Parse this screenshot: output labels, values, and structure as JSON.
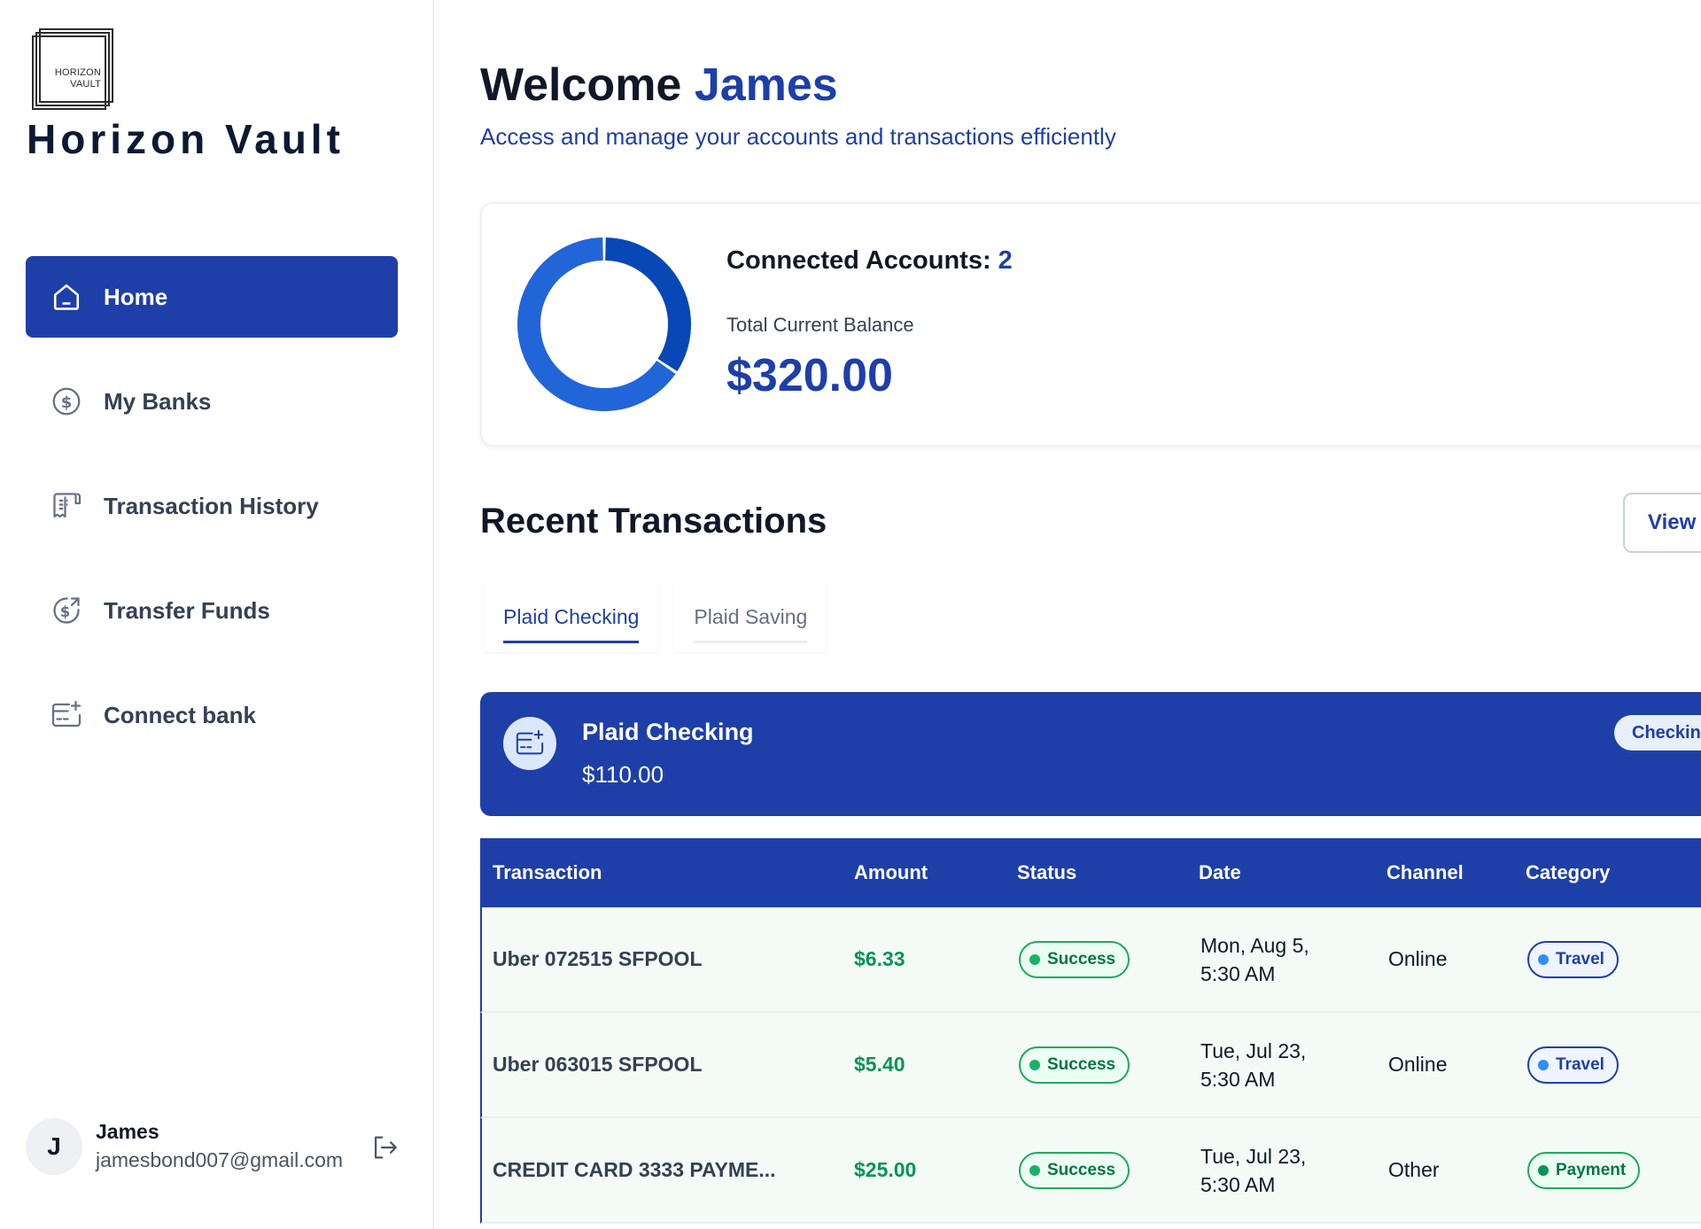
{
  "brand": {
    "logo_text_line1": "HORIZON",
    "logo_text_line2": "VAULT",
    "name": "Horizon Vault"
  },
  "nav": {
    "items": [
      {
        "label": "Home",
        "icon": "home-icon",
        "active": true
      },
      {
        "label": "My Banks",
        "icon": "dollar-circle-icon",
        "active": false
      },
      {
        "label": "Transaction History",
        "icon": "receipt-icon",
        "active": false
      },
      {
        "label": "Transfer Funds",
        "icon": "money-send-icon",
        "active": false
      },
      {
        "label": "Connect bank",
        "icon": "card-add-icon",
        "active": false
      }
    ]
  },
  "user": {
    "initial": "J",
    "name": "James",
    "email": "jamesbond007@gmail.com"
  },
  "header": {
    "welcome": "Welcome",
    "name": "James",
    "subtitle": "Access and manage your accounts and transactions efficiently"
  },
  "summary": {
    "connected_label": "Connected Accounts:",
    "connected_count": "2",
    "balance_label": "Total Current Balance",
    "balance_value": "$320.00",
    "donut": {
      "segments": [
        {
          "value": 110,
          "color": "#0747b6"
        },
        {
          "value": 210,
          "color": "#2265d8"
        }
      ]
    }
  },
  "recent": {
    "title": "Recent Transactions",
    "view_all": "View",
    "tabs": [
      {
        "label": "Plaid Checking",
        "active": true
      },
      {
        "label": "Plaid Saving",
        "active": false
      }
    ]
  },
  "account": {
    "name": "Plaid Checking",
    "balance": "$110.00",
    "badge": "Checking"
  },
  "table": {
    "headers": [
      "Transaction",
      "Amount",
      "Status",
      "Date",
      "Channel",
      "Category"
    ],
    "rows": [
      {
        "name": "Uber 072515 SFPOOL",
        "amount": "$6.33",
        "status": "Success",
        "date_line1": "Mon, Aug 5,",
        "date_line2": "5:30 AM",
        "channel": "Online",
        "category": "Travel"
      },
      {
        "name": "Uber 063015 SFPOOL",
        "amount": "$5.40",
        "status": "Success",
        "date_line1": "Tue, Jul 23,",
        "date_line2": "5:30 AM",
        "channel": "Online",
        "category": "Travel"
      },
      {
        "name": "CREDIT CARD 3333 PAYME...",
        "amount": "$25.00",
        "status": "Success",
        "date_line1": "Tue, Jul 23,",
        "date_line2": "5:30 AM",
        "channel": "Other",
        "category": "Payment"
      }
    ]
  },
  "colors": {
    "primary": "#1e3fa8",
    "success": "#079455",
    "row_bg": "#f4fbf6"
  }
}
